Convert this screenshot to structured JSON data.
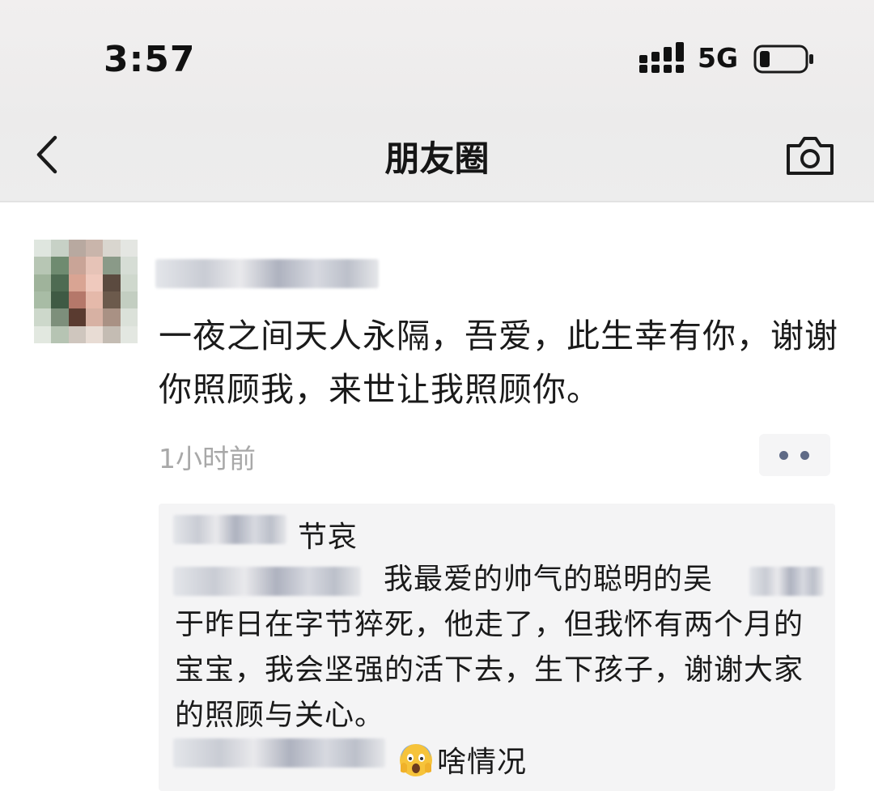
{
  "status_bar": {
    "time": "3:57",
    "network": "5G",
    "battery_level": 0.15
  },
  "nav": {
    "title": "朋友圈",
    "back_icon": "chevron-left-icon",
    "camera_icon": "camera-icon"
  },
  "post": {
    "text": "一夜之间天人永隔，吾爱，此生幸有你，谢谢你照顾我，来世让我照顾你。",
    "time": "1小时前",
    "more_icon": "more-dots-icon"
  },
  "comments": [
    {
      "text": "节哀"
    },
    {
      "text": "我最爱的帅气的聪明的吴　　　于昨日在字节猝死，他走了，但我怀有两个月的宝宝，我会坚强的活下去，生下孩子，谢谢大家的照顾与关心。"
    },
    {
      "emoji": "screaming-face-emoji",
      "text": "啥情况"
    }
  ],
  "colors": {
    "header_bg": "#ededed",
    "timestamp": "#a8a8a8",
    "comment_bg": "#f4f4f5",
    "more_dots": "#5f6a86"
  }
}
